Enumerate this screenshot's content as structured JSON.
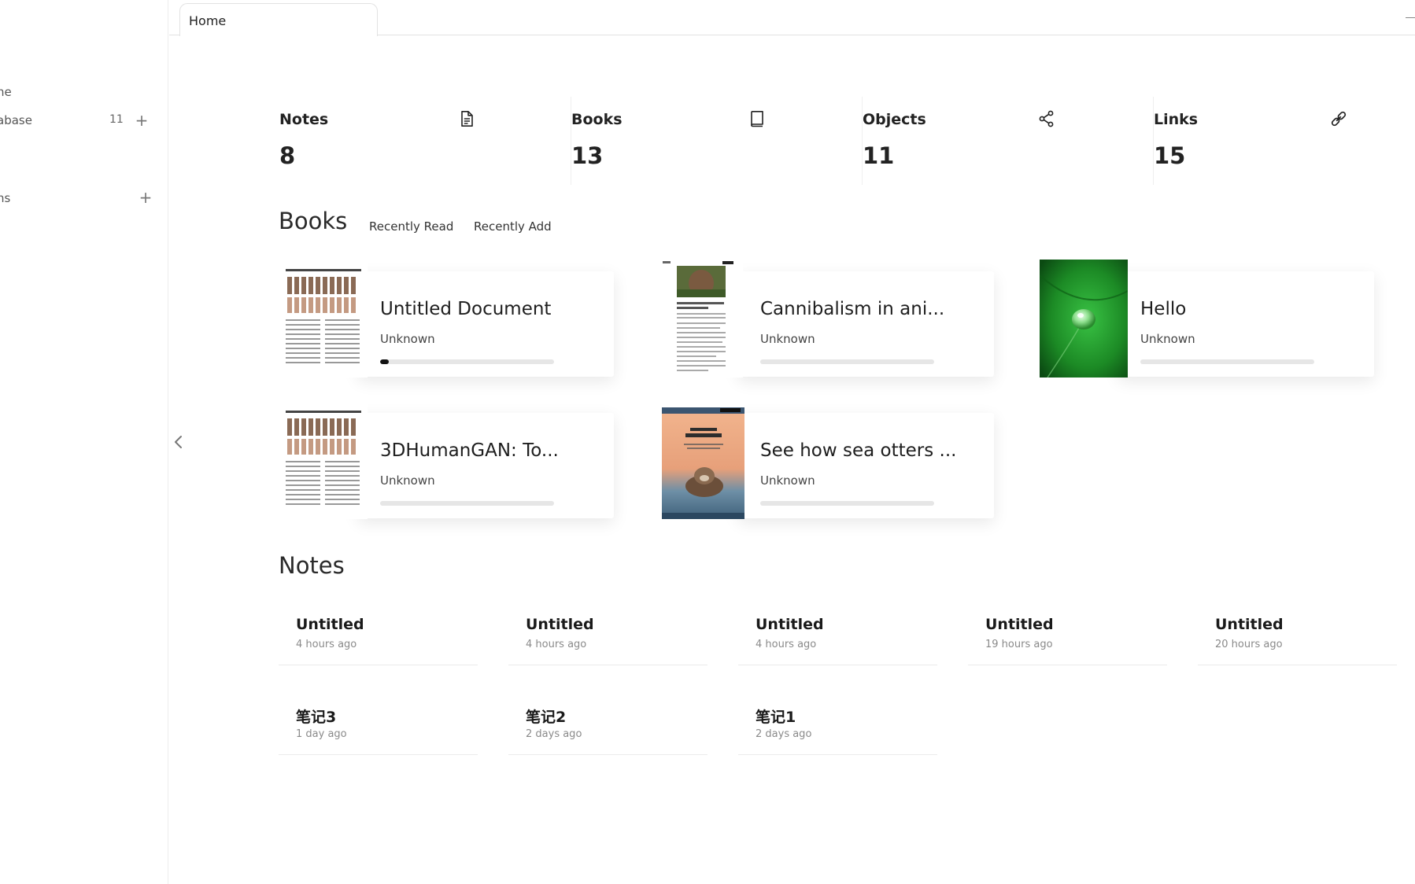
{
  "sidebar": {
    "items": [
      {
        "label": "ne"
      },
      {
        "label": "abase",
        "count": "11"
      },
      {
        "label": "ns"
      }
    ]
  },
  "tabs": [
    {
      "label": "Home"
    }
  ],
  "stats": [
    {
      "label": "Notes",
      "value": "8",
      "icon": "document-icon"
    },
    {
      "label": "Books",
      "value": "13",
      "icon": "book-icon"
    },
    {
      "label": "Objects",
      "value": "11",
      "icon": "share-icon"
    },
    {
      "label": "Links",
      "value": "15",
      "icon": "link-icon"
    }
  ],
  "books_section": {
    "title": "Books",
    "filters": [
      "Recently Read",
      "Recently Add"
    ],
    "items": [
      {
        "title": "Untitled Document",
        "author": "Unknown",
        "progress": 0.05,
        "cover": "paper"
      },
      {
        "title": "Cannibalism in ani...",
        "author": "Unknown",
        "progress": 0,
        "cover": "article"
      },
      {
        "title": "Hello",
        "author": "Unknown",
        "progress": 0,
        "cover": "leaf-photo"
      },
      {
        "title": "3DHumanGAN: To...",
        "author": "Unknown",
        "progress": 0,
        "cover": "paper"
      },
      {
        "title": "See how sea otters ...",
        "author": "Unknown",
        "progress": 0,
        "cover": "magazine"
      }
    ]
  },
  "notes_section": {
    "title": "Notes",
    "items": [
      {
        "title": "Untitled",
        "time": "4 hours ago"
      },
      {
        "title": "Untitled",
        "time": "4 hours ago"
      },
      {
        "title": "Untitled",
        "time": "4 hours ago"
      },
      {
        "title": "Untitled",
        "time": "19 hours ago"
      },
      {
        "title": "Untitled",
        "time": "20 hours ago"
      },
      {
        "title": "笔记3",
        "time": "1 day ago"
      },
      {
        "title": "笔记2",
        "time": "2 days ago"
      },
      {
        "title": "笔记1",
        "time": "2 days ago"
      }
    ]
  },
  "colors": {
    "progress_fill": "#111111",
    "progress_track": "#e6e6e6",
    "leaf_green": "#1f9a2c",
    "otter_bg": "#e9a27a"
  }
}
